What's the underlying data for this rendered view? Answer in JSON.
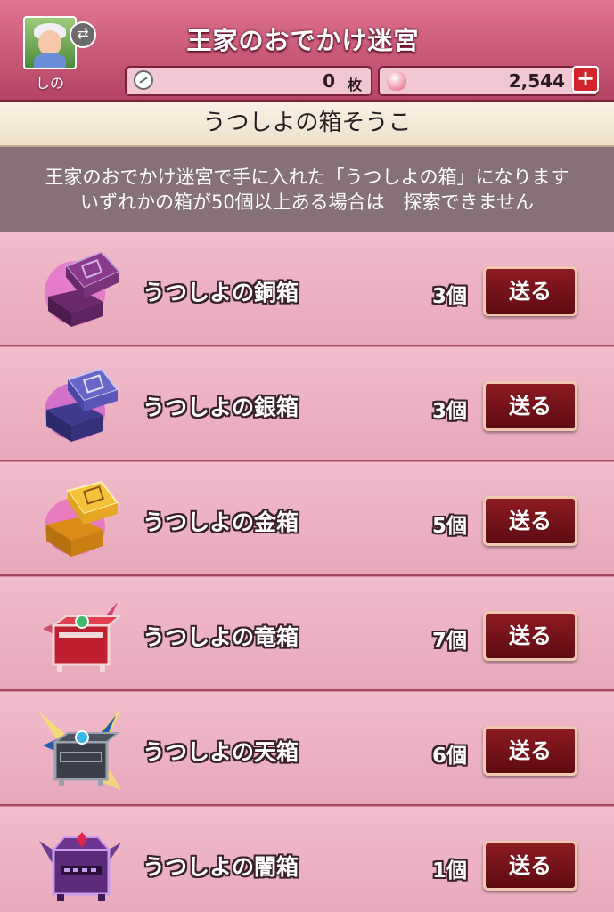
{
  "header": {
    "title": "王家のおでかけ迷宮",
    "player_name": "しの",
    "medals": {
      "value": "0",
      "unit": "枚",
      "icon": "medal-icon"
    },
    "gems": {
      "value": "2,544",
      "plus_label": "+",
      "icon": "gem-icon"
    }
  },
  "section": {
    "title": "うつしよの箱そうこ"
  },
  "info": {
    "line1": "王家のおでかけ迷宮で手に入れた「うつしよの箱」になります",
    "line2": "いずれかの箱が50個以上ある場合は　探索できません"
  },
  "items": [
    {
      "name": "うつしよの銅箱",
      "count": "3個",
      "button": "送る",
      "color": "#8a3a8a"
    },
    {
      "name": "うつしよの銀箱",
      "count": "3個",
      "button": "送る",
      "color": "#5a56b8"
    },
    {
      "name": "うつしよの金箱",
      "count": "5個",
      "button": "送る",
      "color": "#e7a623"
    },
    {
      "name": "うつしよの竜箱",
      "count": "7個",
      "button": "送る",
      "color": "#c01f2f"
    },
    {
      "name": "うつしよの天箱",
      "count": "6個",
      "button": "送る",
      "color": "#3b3f4a"
    },
    {
      "name": "うつしよの闇箱",
      "count": "1個",
      "button": "送る",
      "color": "#5b2a79"
    }
  ]
}
